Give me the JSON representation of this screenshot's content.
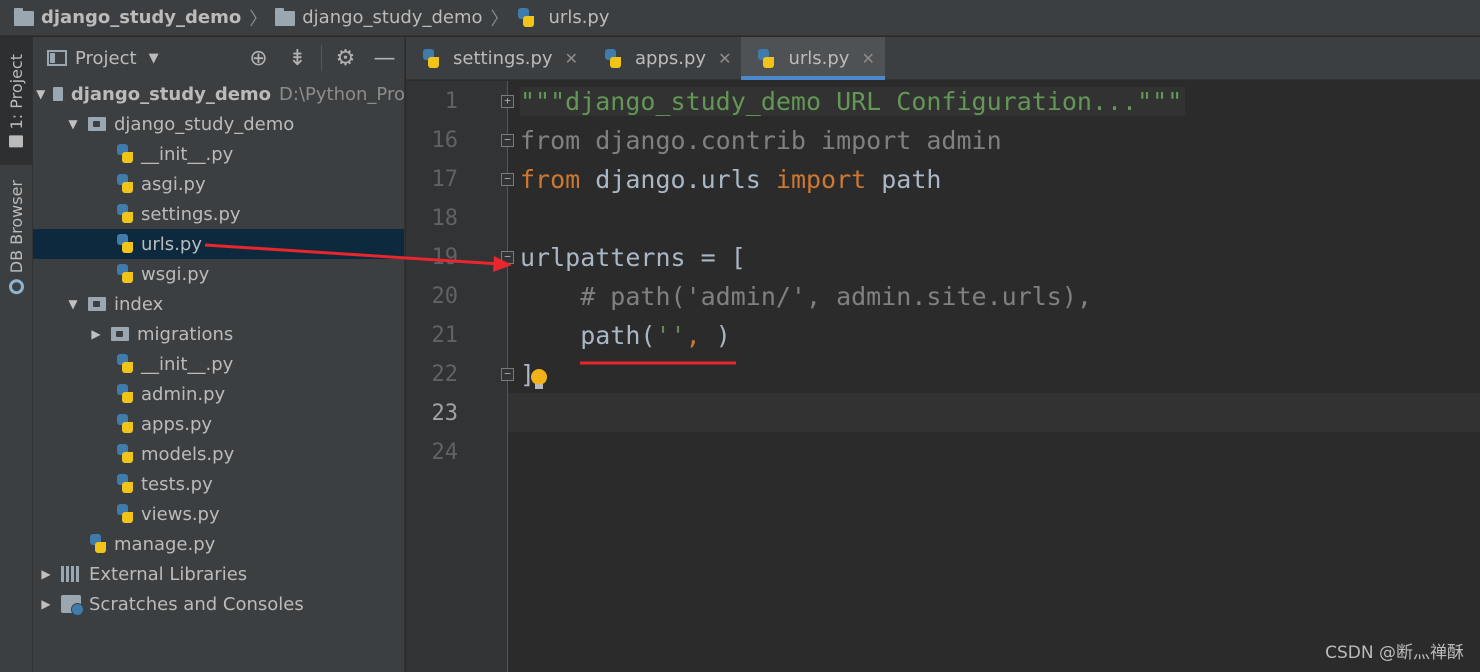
{
  "breadcrumb": [
    {
      "label": "django_study_demo",
      "icon": "folder-icon"
    },
    {
      "label": "django_study_demo",
      "icon": "folder-icon"
    },
    {
      "label": "urls.py",
      "icon": "python-file-icon"
    }
  ],
  "side_stripe": {
    "project_tab": "1: Project",
    "db_tab": "DB Browser"
  },
  "project_panel": {
    "title": "Project",
    "toolbar_icons": [
      "locate-icon",
      "collapse-all-icon",
      "gear-icon",
      "hide-icon"
    ],
    "tree": [
      {
        "label": "django_study_demo",
        "hint": "D:\\Python_Pro",
        "type": "folder",
        "expanded": true
      },
      {
        "label": "django_study_demo",
        "type": "package",
        "expanded": true
      },
      {
        "label": "__init__.py",
        "type": "python"
      },
      {
        "label": "asgi.py",
        "type": "python"
      },
      {
        "label": "settings.py",
        "type": "python"
      },
      {
        "label": "urls.py",
        "type": "python",
        "selected": true
      },
      {
        "label": "wsgi.py",
        "type": "python"
      },
      {
        "label": "index",
        "type": "package",
        "expanded": true
      },
      {
        "label": "migrations",
        "type": "package",
        "expanded": false
      },
      {
        "label": "__init__.py",
        "type": "python"
      },
      {
        "label": "admin.py",
        "type": "python"
      },
      {
        "label": "apps.py",
        "type": "python"
      },
      {
        "label": "models.py",
        "type": "python"
      },
      {
        "label": "tests.py",
        "type": "python"
      },
      {
        "label": "views.py",
        "type": "python"
      },
      {
        "label": "manage.py",
        "type": "python"
      },
      {
        "label": "External Libraries",
        "type": "library",
        "expanded": false
      },
      {
        "label": "Scratches and Consoles",
        "type": "scratches",
        "expanded": false
      }
    ]
  },
  "tabs": [
    {
      "label": "settings.py",
      "active": false
    },
    {
      "label": "apps.py",
      "active": false
    },
    {
      "label": "urls.py",
      "active": true
    }
  ],
  "editor": {
    "current_line": "23",
    "lines": [
      {
        "num": "1",
        "code": "\"\"\"django_study_demo URL Configuration...\"\"\""
      },
      {
        "num": "16",
        "code": "from django.contrib import admin"
      },
      {
        "num": "17",
        "code": "from django.urls import path"
      },
      {
        "num": "18",
        "code": ""
      },
      {
        "num": "19",
        "code": "urlpatterns = ["
      },
      {
        "num": "20",
        "code": "    # path('admin/', admin.site.urls),"
      },
      {
        "num": "21",
        "code": "    path('', )"
      },
      {
        "num": "22",
        "code": "]"
      },
      {
        "num": "23",
        "code": ""
      },
      {
        "num": "24",
        "code": ""
      }
    ]
  },
  "colors": {
    "keyword": "#cc7832",
    "comment": "#808080",
    "string": "#6a8759",
    "docstring": "#629755",
    "annotation": "#e8262b",
    "tab_underline": "#4a88c7",
    "selection": "#0d293e"
  },
  "watermark": "CSDN @断灬禅酥"
}
